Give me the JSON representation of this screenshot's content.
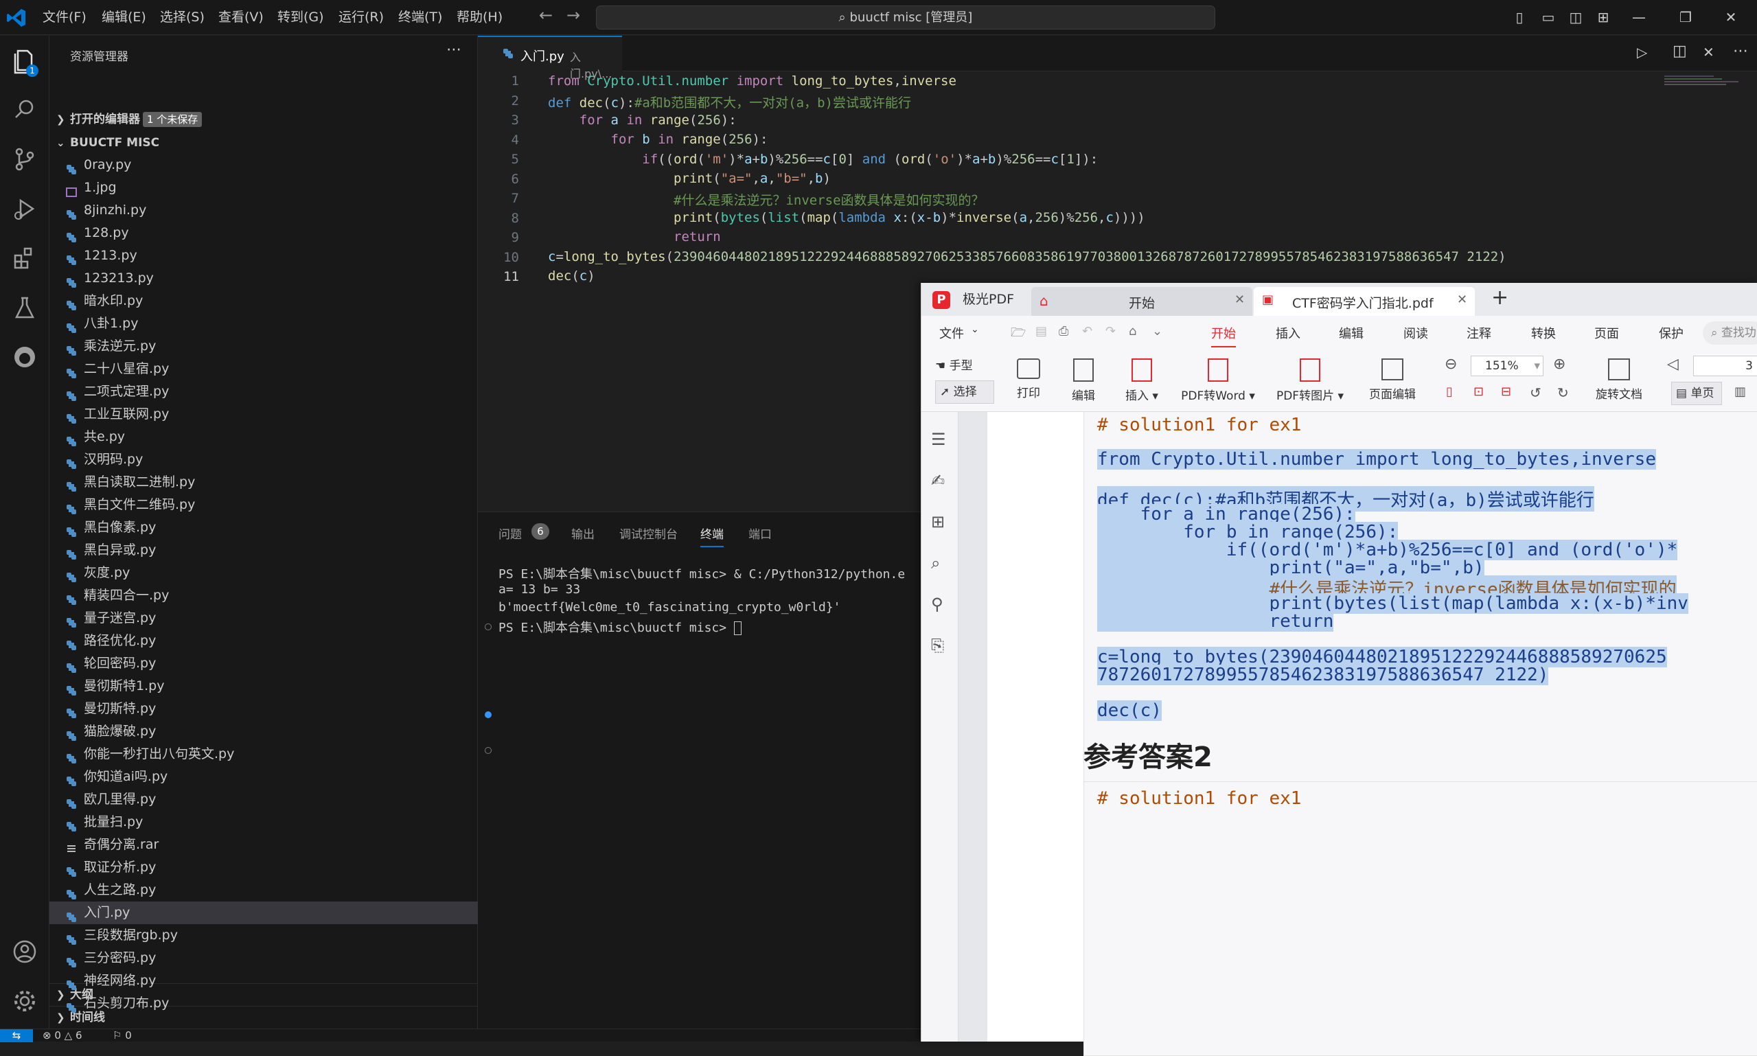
{
  "menu": [
    "文件(F)",
    "编辑(E)",
    "选择(S)",
    "查看(V)",
    "转到(G)",
    "运行(R)",
    "终端(T)",
    "帮助(H)"
  ],
  "search": "buuctf misc [管理员]",
  "sidebar": {
    "title": "资源管理器",
    "open_editors": "打开的编辑器",
    "unsaved_badge": "1 个未保存",
    "folder": "BUUCTF MISC",
    "files": [
      "0ray.py",
      "1.jpg",
      "8jinzhi.py",
      "128.py",
      "1213.py",
      "123213.py",
      "暗水印.py",
      "八卦1.py",
      "乘法逆元.py",
      "二十八星宿.py",
      "二项式定理.py",
      "工业互联网.py",
      "共e.py",
      "汉明码.py",
      "黑白读取二进制.py",
      "黑白文件二维码.py",
      "黑白像素.py",
      "黑白异或.py",
      "灰度.py",
      "精装四合一.py",
      "量子迷宫.py",
      "路径优化.py",
      "轮回密码.py",
      "曼彻斯特1.py",
      "曼切斯特.py",
      "猫脸爆破.py",
      "你能一秒打出八句英文.py",
      "你知道ai吗.py",
      "欧几里得.py",
      "批量扫.py",
      "奇偶分离.rar",
      "取证分析.py",
      "人生之路.py",
      "入门.py",
      "三段数据rgb.py",
      "三分密码.py",
      "神经网络.py",
      "石头剪刀布.py"
    ],
    "outline": "大纲",
    "timeline": "时间线"
  },
  "activity_badge": "1",
  "editor": {
    "tab_name": "入门.py",
    "tab_path": "入门.py\\...",
    "line_numbers": [
      "1",
      "2",
      "3",
      "4",
      "5",
      "6",
      "7",
      "8",
      "9",
      "10",
      "11"
    ]
  },
  "panel": {
    "tabs": [
      "问题",
      "输出",
      "调试控制台",
      "终端",
      "端口"
    ],
    "problems_count": "6",
    "terminal": [
      "PS E:\\脚本合集\\misc\\buuctf misc> & C:/Python312/python.e",
      "a= 13 b= 33",
      "b'moectf{Welc0me_t0_fascinating_crypto_w0rld}'",
      "PS E:\\脚本合集\\misc\\buuctf misc> "
    ]
  },
  "status": {
    "errors": "0",
    "warnings": "6",
    "ports": "0"
  },
  "pdf": {
    "app_name": "极光PDF",
    "tab_home": "开始",
    "tab_doc": "CTF密码学入门指北.pdf",
    "menu": [
      "文件",
      "开始",
      "插入",
      "编辑",
      "阅读",
      "注释",
      "转换",
      "页面",
      "保护"
    ],
    "search_placeholder": "查找功",
    "tools": {
      "hand": "手型",
      "select": "选择",
      "print": "打印",
      "edit": "编辑",
      "insert": "插入",
      "to_word": "PDF转Word",
      "to_image": "PDF转图片",
      "page_edit": "页面编辑",
      "rotate": "旋转文档",
      "single": "单页",
      "zoom": "151%",
      "page_num": "3"
    },
    "doc": {
      "l1": "# solution1 for ex1",
      "l2": "from Crypto.Util.number import long_to_bytes,inverse",
      "l3": "def dec(c):#a和b范围都不大，一对对(a，b)尝试或许能行",
      "l4": "    for a in range(256):",
      "l5": "        for b in range(256):",
      "l6": "            if((ord('m')*a+b)%256==c[0] and (ord('o')*",
      "l7": "                print(\"a=\",a,\"b=\",b)",
      "l8": "                #什么是乘法逆元？inverse函数具体是如何实现的",
      "l9": "                print(bytes(list(map(lambda x:(x-b)*inv",
      "l10": "                return",
      "l11": "c=long_to_bytes(2390460448021895122292446888589270625",
      "l12": "787260172789955785462383197588636547 2122)",
      "l13": "dec(c)",
      "heading": "参考答案2",
      "l14": "# solution1 for ex1"
    }
  }
}
